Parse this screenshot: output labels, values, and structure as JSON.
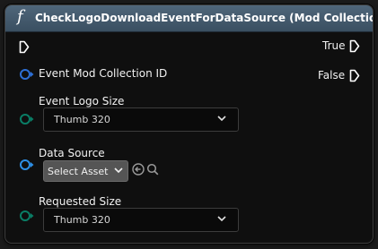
{
  "node": {
    "title": "CheckLogoDownloadEventForDataSource (Mod Collection)",
    "function_icon": "f",
    "header_color": "#4a5f72"
  },
  "outputs": {
    "true_label": "True",
    "false_label": "False"
  },
  "inputs": {
    "event_mod_collection_id": {
      "label": "Event Mod Collection ID",
      "pin_color": "#2d6fd6"
    },
    "event_logo_size": {
      "label": "Event Logo Size",
      "value": "Thumb 320",
      "pin_color": "#0a7e66"
    },
    "data_source": {
      "label": "Data Source",
      "value": "Select Asset",
      "pin_color": "#2d8fe6"
    },
    "requested_size": {
      "label": "Requested Size",
      "value": "Thumb 320",
      "pin_color": "#0a7e66"
    }
  },
  "icons": {
    "exec_in": "exec-pin-icon",
    "exec_out": "exec-pin-icon",
    "use_selected": "arrow-left-circle-icon",
    "browse": "search-icon",
    "dropdown": "chevron-down-icon"
  }
}
